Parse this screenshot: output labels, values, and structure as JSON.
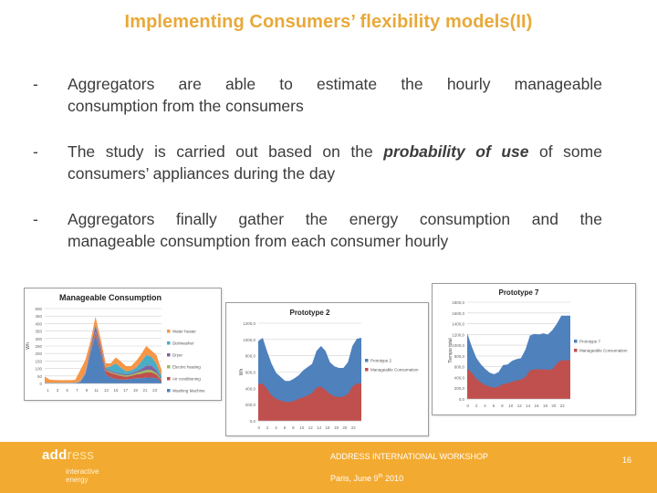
{
  "title": "Implementing Consumers’ flexibility models(II)",
  "bullets": [
    {
      "dash": "-",
      "line1": "Aggregators are able to estimate the hourly manageable",
      "line2": "consumption from the consumers"
    },
    {
      "dash": "-",
      "pre": "The study is carried out based on the ",
      "emph": "probability of use",
      "post": " of some consumers’ appliances during the day"
    },
    {
      "dash": "-",
      "line1": "Aggregators finally gather the energy consumption and the",
      "line2": "manageable consumption from each consumer hourly"
    }
  ],
  "footer": {
    "logo_bold": "add",
    "logo_light": "ress",
    "logo_sub1": "interactive",
    "logo_sub2": "energy",
    "event": "ADDRESS INTERNATIONAL WORKSHOP",
    "place": "Paris, June 9",
    "place_sup": "th",
    "place_year": " 2010",
    "page": "16"
  },
  "colors": {
    "accent": "#f3aa30",
    "title": "#e8a93a",
    "blue": "#4f81bd",
    "red": "#c0504d"
  },
  "chart_data": [
    {
      "type": "area",
      "title": "Manageable Consumption",
      "ylabel": "Wh",
      "xlabel": "",
      "ylim": [
        0,
        500
      ],
      "yticks": [
        "0",
        "50",
        "100",
        "150",
        "200",
        "250",
        "300",
        "350",
        "400",
        "450",
        "500"
      ],
      "x": [
        1,
        2,
        3,
        4,
        5,
        6,
        7,
        8,
        9,
        10,
        11,
        12,
        13,
        14,
        15,
        16,
        17,
        18,
        19,
        20,
        21,
        22,
        23,
        24
      ],
      "xticks": [
        "1",
        "3",
        "5",
        "7",
        "9",
        "11",
        "13",
        "15",
        "17",
        "19",
        "21",
        "23"
      ],
      "stacked": true,
      "series": [
        {
          "name": "Washing Machine",
          "color": "#4f81bd",
          "values": [
            2,
            1,
            1,
            1,
            1,
            1,
            2,
            10,
            60,
            200,
            320,
            200,
            60,
            40,
            30,
            25,
            25,
            30,
            35,
            35,
            40,
            40,
            35,
            10
          ]
        },
        {
          "name": "Air conditioning",
          "color": "#c0504d",
          "values": [
            1,
            1,
            1,
            1,
            1,
            1,
            1,
            3,
            5,
            10,
            20,
            25,
            25,
            30,
            30,
            25,
            20,
            20,
            25,
            30,
            35,
            35,
            25,
            10
          ]
        },
        {
          "name": "Electric heating",
          "color": "#9bbb59",
          "values": [
            1,
            1,
            1,
            1,
            1,
            1,
            1,
            2,
            3,
            5,
            6,
            6,
            6,
            6,
            6,
            8,
            8,
            8,
            10,
            15,
            15,
            15,
            10,
            5
          ]
        },
        {
          "name": "Dryer",
          "color": "#8064a2",
          "values": [
            1,
            1,
            1,
            1,
            1,
            1,
            1,
            2,
            5,
            20,
            40,
            25,
            10,
            8,
            8,
            8,
            8,
            8,
            10,
            15,
            30,
            30,
            20,
            5
          ]
        },
        {
          "name": "Dishwasher",
          "color": "#4bacc6",
          "values": [
            1,
            1,
            1,
            1,
            1,
            1,
            1,
            2,
            3,
            5,
            10,
            5,
            5,
            30,
            60,
            40,
            20,
            20,
            25,
            50,
            70,
            60,
            40,
            20
          ]
        },
        {
          "name": "Water heater",
          "color": "#f79646",
          "values": [
            40,
            20,
            18,
            17,
            17,
            17,
            18,
            70,
            80,
            40,
            50,
            40,
            30,
            20,
            40,
            40,
            35,
            30,
            45,
            50,
            60,
            40,
            60,
            40
          ]
        }
      ],
      "legend": "right"
    },
    {
      "type": "area",
      "title": "Prototype 2",
      "ylabel": "Wh",
      "xlabel": "",
      "ylim": [
        0,
        1200
      ],
      "yticks": [
        "0,0",
        "200,0",
        "400,0",
        "600,0",
        "800,0",
        "1000,0",
        "1200,0"
      ],
      "xticks": [
        "0",
        "2",
        "4",
        "6",
        "8",
        "10",
        "12",
        "14",
        "16",
        "18",
        "20",
        "22"
      ],
      "x": [
        0,
        1,
        2,
        3,
        4,
        5,
        6,
        7,
        8,
        9,
        10,
        11,
        12,
        13,
        14,
        15,
        16,
        17,
        18,
        19,
        20,
        21,
        22,
        23
      ],
      "stacked": false,
      "series": [
        {
          "name": "Prototype 2",
          "color": "#4f81bd",
          "values": [
            980,
            1020,
            850,
            700,
            590,
            540,
            490,
            490,
            520,
            560,
            620,
            660,
            700,
            860,
            920,
            860,
            720,
            670,
            650,
            650,
            720,
            920,
            1010,
            1020
          ]
        },
        {
          "name": "Manageable Consumation",
          "color": "#c0504d",
          "values": [
            450,
            460,
            390,
            310,
            270,
            250,
            235,
            230,
            245,
            270,
            290,
            310,
            340,
            410,
            420,
            380,
            330,
            300,
            290,
            300,
            330,
            420,
            460,
            460
          ]
        }
      ],
      "legend": "right"
    },
    {
      "type": "area",
      "title": "Prototype 7",
      "ylabel": "Tiempo total",
      "xlabel": "",
      "ylim": [
        0,
        1800
      ],
      "yticks": [
        "0,0",
        "200,0",
        "400,0",
        "600,0",
        "800,0",
        "1000,0",
        "1200,0",
        "1400,0",
        "1600,0",
        "1800,0"
      ],
      "xticks": [
        "0",
        "2",
        "4",
        "6",
        "8",
        "10",
        "12",
        "14",
        "16",
        "18",
        "20",
        "22"
      ],
      "x": [
        0,
        1,
        2,
        3,
        4,
        5,
        6,
        7,
        8,
        9,
        10,
        11,
        12,
        13,
        14,
        15,
        16,
        17,
        18,
        19,
        20,
        21,
        22,
        23
      ],
      "stacked": false,
      "series": [
        {
          "name": "Prototype 7",
          "color": "#4f81bd",
          "values": [
            1220,
            980,
            770,
            650,
            560,
            490,
            460,
            500,
            630,
            640,
            710,
            740,
            760,
            920,
            1180,
            1210,
            1200,
            1220,
            1200,
            1280,
            1400,
            1550,
            1550,
            1550
          ]
        },
        {
          "name": "Manageable Consumation",
          "color": "#c0504d",
          "values": [
            560,
            490,
            380,
            310,
            260,
            230,
            210,
            230,
            280,
            290,
            320,
            340,
            360,
            410,
            530,
            550,
            550,
            550,
            545,
            550,
            660,
            720,
            720,
            720
          ]
        }
      ],
      "legend": "right"
    }
  ]
}
